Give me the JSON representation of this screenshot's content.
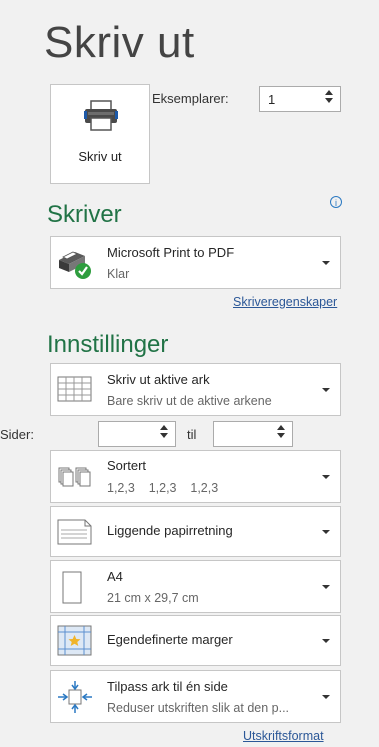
{
  "page": {
    "title": "Skriv ut"
  },
  "print_button": {
    "label": "Skriv ut",
    "icon": "printer-icon"
  },
  "copies": {
    "label": "Eksemplarer:",
    "value": "1"
  },
  "printer_section": {
    "heading": "Skriver",
    "printer_name": "Microsoft Print to PDF",
    "printer_status": "Klar",
    "properties_link": "Skriveregenskaper",
    "status_color": "#2e9d3e"
  },
  "settings_section": {
    "heading": "Innstillinger",
    "what_to_print": {
      "title": "Skriv ut aktive ark",
      "subtitle": "Bare skriv ut de aktive arkene"
    },
    "pages": {
      "label": "Sider:",
      "to_label": "til",
      "from": "",
      "to": ""
    },
    "collation": {
      "title": "Sortert",
      "subtitle": "1,2,3    1,2,3    1,2,3"
    },
    "orientation": {
      "title": "Liggende papirretning"
    },
    "paper_size": {
      "title": "A4",
      "subtitle": "21 cm x 29,7 cm"
    },
    "margins": {
      "title": "Egendefinerte marger"
    },
    "scaling": {
      "title": "Tilpass ark til én side",
      "subtitle": "Reduser utskriften slik at den p..."
    },
    "page_setup_link": "Utskriftsformat"
  },
  "colors": {
    "accent": "#217346",
    "link": "#2b5797"
  }
}
